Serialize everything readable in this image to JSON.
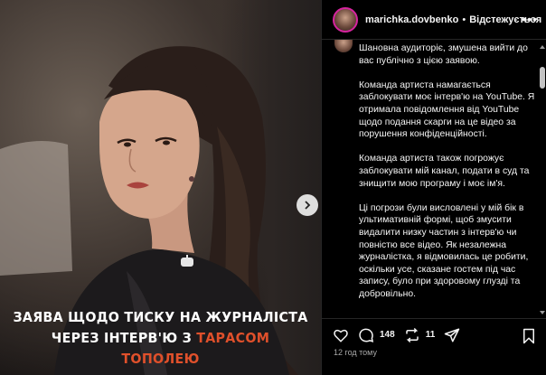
{
  "post": {
    "overlay_line1": "ЗАЯВА ЩОДО ТИСКУ НА ЖУРНАЛІСТА",
    "overlay_line2_prefix": "ЧЕРЕЗ ІНТЕРВ'Ю З ",
    "overlay_line2_highlight": "ТАРАСОМ ТОПОЛЕЮ",
    "highlight_color": "#e0502b"
  },
  "header": {
    "username": "marichka.dovbenko",
    "separator": "•",
    "follow_label": "Відстежується",
    "more_label": "•••"
  },
  "caption": {
    "paragraphs": [
      "Шановна аудиторіє, змушена вийти до вас публічно з цією заявою.",
      "Команда артиста намагається заблокувати моє інтерв'ю на YouTube. Я отримала повідомлення від YouTube щодо подання скарги на це відео за порушення конфіденційності.",
      "Команда артиста також погрожує заблокувати мій канал, подати в суд та знищити мою програму і моє ім'я.",
      "Ці погрози були висловлені у мій бік в ультимативній формі, щоб змусити видалити низку частин з інтерв'ю чи повністю все відео. Як незалежна журналістка, я відмовилась це робити, оскільки усе, сказане гостем під час запису, було при здоровому глузді та добровільно."
    ]
  },
  "actions": {
    "like_icon": "heart-icon",
    "comment_icon": "comment-icon",
    "comment_count": "148",
    "repost_icon": "repost-icon",
    "repost_count": "11",
    "share_icon": "share-icon",
    "save_icon": "bookmark-icon"
  },
  "timestamp": "12 год тому"
}
